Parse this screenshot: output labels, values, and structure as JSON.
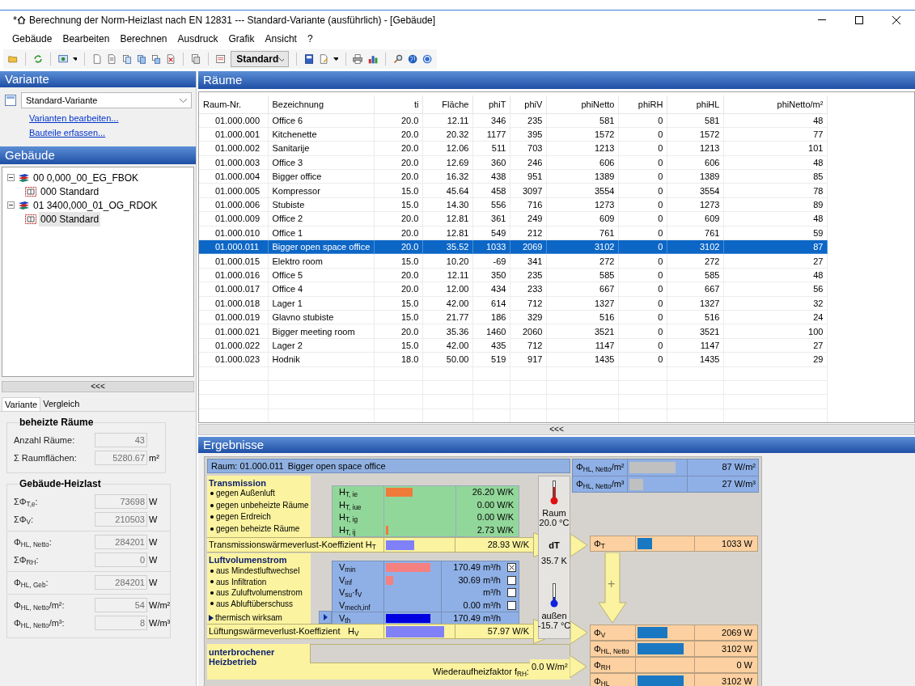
{
  "window": {
    "title_mark": "*",
    "title": "Berechnung der Norm-Heizlast nach EN 12831 --- Standard-Variante (ausführlich) - [Gebäude]"
  },
  "menu": [
    "Gebäude",
    "Bearbeiten",
    "Berechnen",
    "Ausdruck",
    "Grafik",
    "Ansicht",
    "?"
  ],
  "toolbar": {
    "view_combo": "Standard"
  },
  "variant_panel": {
    "header": "Variante",
    "combo": "Standard-Variante",
    "links": [
      "Varianten bearbeiten...",
      "Bauteile erfassen..."
    ]
  },
  "building_panel": {
    "header": "Gebäude",
    "tree": [
      {
        "label": "00 0,000_00_EG_FBOK",
        "expanded": true,
        "children": [
          {
            "label": "000 Standard",
            "selected": false
          }
        ]
      },
      {
        "label": "01 3400,000_01_OG_RDOK",
        "expanded": true,
        "children": [
          {
            "label": "000 Standard",
            "selected": true
          }
        ]
      }
    ]
  },
  "left_splitter": "<<<",
  "summary_tabs": [
    {
      "label": "Variante",
      "selected": true
    },
    {
      "label": "Vergleich",
      "selected": false
    }
  ],
  "summary_groups": [
    {
      "title": "beheizte Räume",
      "sections": [
        {
          "fields": [
            {
              "label": "Anzahl Räume:",
              "value": "43"
            },
            {
              "label": "Σ Raumflächen:",
              "value": "5280.67",
              "unit": "m²"
            }
          ]
        }
      ]
    },
    {
      "title": "Gebäude-Heizlast",
      "sections": [
        {
          "fields": [
            {
              "label": "ΣΦ$_{T,e}$:",
              "value": "73698",
              "unit": "W"
            },
            {
              "label": "ΣΦ$_{V}$:",
              "value": "210503",
              "unit": "W"
            }
          ]
        },
        {
          "fields": [
            {
              "label": "Φ$_{HL, Netto}$:",
              "value": "284201",
              "unit": "W"
            },
            {
              "label": "ΣΦ$_{RH}$:",
              "value": "0",
              "unit": "W"
            }
          ]
        },
        {
          "fields": [
            {
              "label": "Φ$_{HL, Geb}$:",
              "value": "284201",
              "unit": "W"
            }
          ]
        },
        {
          "fields": [
            {
              "label": "Φ$_{HL, Netto}$/m²:",
              "value": "54",
              "unit": "W/m²"
            },
            {
              "label": "Φ$_{HL, Netto}$/m³:",
              "value": "8",
              "unit": "W/m³"
            }
          ]
        }
      ]
    }
  ],
  "rooms": {
    "header": "Räume",
    "columns": [
      "Raum-Nr.",
      "Bezeichnung",
      "ti",
      "Fläche",
      "phiT",
      "phiV",
      "phiNetto",
      "phiRH",
      "phiHL",
      "phiNetto/m²"
    ],
    "rows": [
      {
        "cells": [
          "01.000.000",
          "Office 6",
          "20.0",
          "12.11",
          "346",
          "235",
          "581",
          "0",
          "581",
          "48"
        ],
        "selected": false
      },
      {
        "cells": [
          "01.000.001",
          "Kitchenette",
          "20.0",
          "20.32",
          "1177",
          "395",
          "1572",
          "0",
          "1572",
          "77"
        ],
        "selected": false
      },
      {
        "cells": [
          "01.000.002",
          "Sanitarije",
          "20.0",
          "12.06",
          "511",
          "703",
          "1213",
          "0",
          "1213",
          "101"
        ],
        "selected": false
      },
      {
        "cells": [
          "01.000.003",
          "Office 3",
          "20.0",
          "12.69",
          "360",
          "246",
          "606",
          "0",
          "606",
          "48"
        ],
        "selected": false
      },
      {
        "cells": [
          "01.000.004",
          "Bigger office",
          "20.0",
          "16.32",
          "438",
          "951",
          "1389",
          "0",
          "1389",
          "85"
        ],
        "selected": false
      },
      {
        "cells": [
          "01.000.005",
          "Kompressor",
          "15.0",
          "45.64",
          "458",
          "3097",
          "3554",
          "0",
          "3554",
          "78"
        ],
        "selected": false
      },
      {
        "cells": [
          "01.000.006",
          "Stubiste",
          "15.0",
          "14.30",
          "556",
          "716",
          "1273",
          "0",
          "1273",
          "89"
        ],
        "selected": false
      },
      {
        "cells": [
          "01.000.009",
          "Office 2",
          "20.0",
          "12.81",
          "361",
          "249",
          "609",
          "0",
          "609",
          "48"
        ],
        "selected": false
      },
      {
        "cells": [
          "01.000.010",
          "Office 1",
          "20.0",
          "12.81",
          "549",
          "212",
          "761",
          "0",
          "761",
          "59"
        ],
        "selected": false
      },
      {
        "cells": [
          "01.000.011",
          "Bigger open space office",
          "20.0",
          "35.52",
          "1033",
          "2069",
          "3102",
          "0",
          "3102",
          "87"
        ],
        "selected": true
      },
      {
        "cells": [
          "01.000.015",
          "Elektro room",
          "15.0",
          "10.20",
          "-69",
          "341",
          "272",
          "0",
          "272",
          "27"
        ],
        "selected": false
      },
      {
        "cells": [
          "01.000.016",
          "Office 5",
          "20.0",
          "12.11",
          "350",
          "235",
          "585",
          "0",
          "585",
          "48"
        ],
        "selected": false
      },
      {
        "cells": [
          "01.000.017",
          "Office 4",
          "20.0",
          "12.00",
          "434",
          "233",
          "667",
          "0",
          "667",
          "56"
        ],
        "selected": false
      },
      {
        "cells": [
          "01.000.018",
          "Lager 1",
          "15.0",
          "42.00",
          "614",
          "712",
          "1327",
          "0",
          "1327",
          "32"
        ],
        "selected": false
      },
      {
        "cells": [
          "01.000.019",
          "Glavno stubiste",
          "15.0",
          "21.77",
          "186",
          "329",
          "516",
          "0",
          "516",
          "24"
        ],
        "selected": false
      },
      {
        "cells": [
          "01.000.021",
          "Bigger meeting room",
          "20.0",
          "35.36",
          "1460",
          "2060",
          "3521",
          "0",
          "3521",
          "100"
        ],
        "selected": false
      },
      {
        "cells": [
          "01.000.022",
          "Lager 2",
          "15.0",
          "42.00",
          "435",
          "712",
          "1147",
          "0",
          "1147",
          "27"
        ],
        "selected": false
      },
      {
        "cells": [
          "01.000.023",
          "Hodnik",
          "18.0",
          "50.00",
          "519",
          "917",
          "1435",
          "0",
          "1435",
          "29"
        ],
        "selected": false
      }
    ]
  },
  "right_splitter": "<<<",
  "results": {
    "header": "Ergebnisse",
    "room_label": "Raum: 01.000.011",
    "room_name": "Bigger open space office",
    "transmission": {
      "title": "Transmission",
      "items": [
        "gegen Außenluft",
        "gegen unbeheizte Räume",
        "gegen Erdreich",
        "gegen beheizte Räume"
      ],
      "rows": [
        {
          "symbol": "H$_{T, ie}$",
          "level": 0.39,
          "value": "26.20 W/K"
        },
        {
          "symbol": "H$_{T, iue}$",
          "level": 0,
          "value": "0.00 W/K"
        },
        {
          "symbol": "H$_{T, ig}$",
          "level": 0,
          "value": "0.00 W/K"
        },
        {
          "symbol": "H$_{T, ij}$",
          "level": 0.04,
          "value": "2.73 W/K"
        }
      ],
      "total": {
        "label": "Transmissionswärmeverlust-Koeffizient H$_{T}$",
        "level": 0.42,
        "value": "28.93 W/K"
      }
    },
    "ventilation": {
      "title": "Luftvolumenstrom",
      "items": [
        "aus Mindestluftwechsel",
        "aus Infiltration",
        "aus Zuluftvolumenstrom",
        "aus Abluftüberschuss"
      ],
      "thermal_item": "thermisch wirksam",
      "rows": [
        {
          "symbol": "V$_{min}$",
          "level": 0.83,
          "value": "170.49 m³/h",
          "checked": true
        },
        {
          "symbol": "V$_{inf}$",
          "level": 0.13,
          "value": "30.69 m³/h",
          "checked": false
        },
        {
          "symbol": "V$_{su}$·f$_{V}$",
          "level": 0,
          "value": "m³/h",
          "checked": false
        },
        {
          "symbol": "V$_{mech,inf}$",
          "level": 0,
          "value": "0.00 m³/h",
          "checked": false
        }
      ],
      "thermal_row": {
        "symbol": "V$_{th}$",
        "level": 0.83,
        "value": "170.49 m³/h"
      },
      "total": {
        "label": "Lüftungswärmeverlust-Koeffizient",
        "symbol": "H$_{V}$",
        "level": 0.87,
        "value": "57.97 W/K"
      }
    },
    "interrupted": {
      "title": "unterbrochener Heizbetrieb",
      "factor_label": "Wiederaufheizfaktor f$_{RH}$:",
      "factor_value": "0.0 W/m²"
    },
    "temperatures": {
      "inside_label": "Raum",
      "inside_value": "20.0 °C",
      "delta_label": "dT",
      "delta_value": "35.7 K",
      "outside_label": "außen",
      "outside_value": "-15.7 °C"
    },
    "specific": [
      {
        "symbol": "Φ$_{HL, Netto}$/m²",
        "level": 0.82,
        "value": "87 W/m²"
      },
      {
        "symbol": "Φ$_{HL, Netto}$/m³",
        "level": 0.25,
        "value": "27 W/m³"
      }
    ],
    "loads": [
      {
        "symbol": "Φ$_{T}$",
        "level": 0.27,
        "value": "1033 W"
      },
      {
        "symbol": "Φ$_{V}$",
        "level": 0.55,
        "value": "2069 W"
      },
      {
        "symbol": "Φ$_{HL, Netto}$",
        "level": 0.84,
        "value": "3102 W"
      },
      {
        "symbol": "Φ$_{RH}$",
        "level": 0,
        "value": "0 W"
      },
      {
        "symbol": "Φ$_{HL}$",
        "level": 0.84,
        "value": "3102 W"
      }
    ],
    "sum_sign": "+"
  }
}
